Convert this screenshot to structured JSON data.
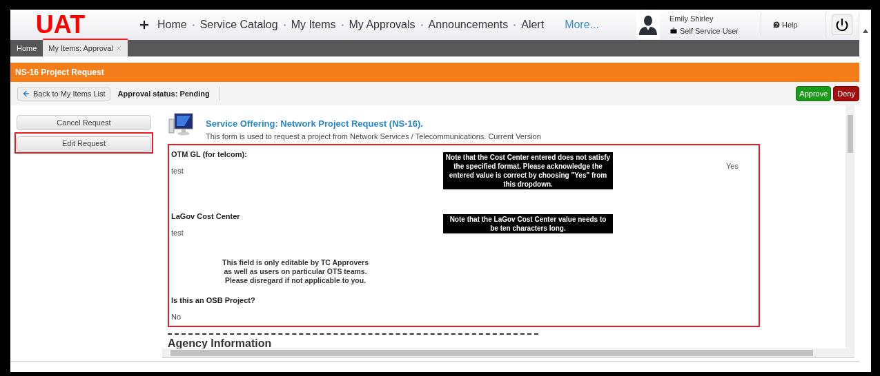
{
  "header": {
    "logo": "UAT",
    "nav": [
      "Home",
      "Service Catalog",
      "My Items",
      "My Approvals",
      "Announcements",
      "Alert"
    ],
    "more": "More...",
    "user": {
      "name": "Emily Shirley",
      "role": "Self Service User"
    },
    "help": "Help"
  },
  "tabs": [
    {
      "label": "Home",
      "selected": false,
      "closable": false
    },
    {
      "label": "My Items: Approval",
      "selected": true,
      "closable": true
    }
  ],
  "page_title": "NS-16 Project Request",
  "toolbar": {
    "back": "Back to My Items List",
    "status": "Approval status: Pending",
    "actions": [
      {
        "label": "Approve",
        "kind": "approve"
      },
      {
        "label": "Deny",
        "kind": "deny"
      }
    ]
  },
  "side_buttons": [
    {
      "label": "Cancel Request",
      "highlighted": false
    },
    {
      "label": "Edit Request",
      "highlighted": true
    }
  ],
  "offering": {
    "title": "Service Offering: Network Project Request (NS-16).",
    "description": "This form is used to request a project from Network Services / Telecommunications. Current Version"
  },
  "form": {
    "highlighted": true,
    "items": [
      {
        "kind": "field",
        "label": "OTM GL (for telcom):",
        "value": "test",
        "note": "Note that the Cost Center entered does not satisfy the specified format. Please acknowledge the entered value is correct by choosing \"Yes\" from this dropdown.",
        "answer": "Yes"
      },
      {
        "kind": "field",
        "label": "LaGov Cost Center",
        "value": "test",
        "note": "Note that the LaGov Cost Center value needs to be ten characters long."
      },
      {
        "kind": "notice",
        "text": "This field is only editable by TC Approvers as well as users on particular OTS teams. Please disregard if not applicable to you."
      },
      {
        "kind": "field",
        "label": "Is this an OSB Project?",
        "value": "No"
      }
    ]
  },
  "next_section": "Agency Information"
}
